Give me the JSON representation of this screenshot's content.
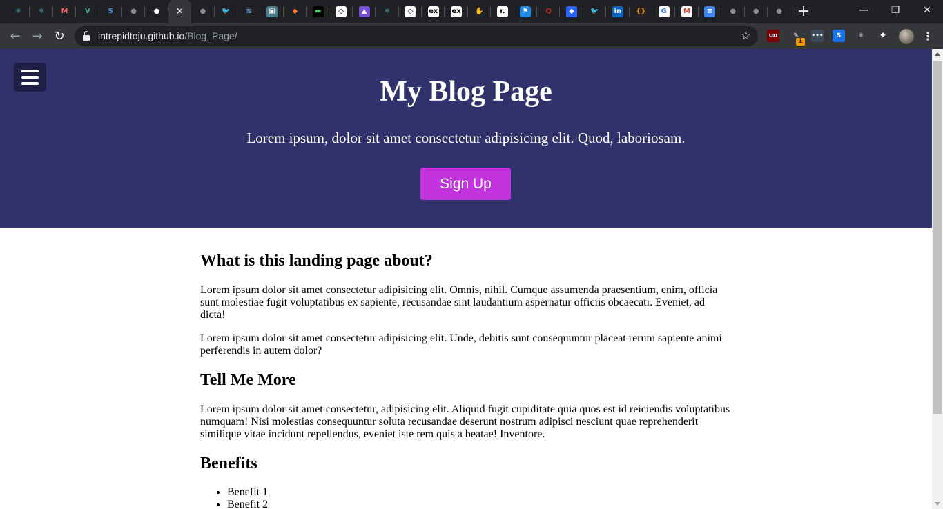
{
  "browser": {
    "tabs": [
      {
        "icon": "react-icon",
        "glyph": "⚛",
        "color": "#61dafb",
        "bg": "transparent"
      },
      {
        "icon": "react-icon",
        "glyph": "⚛",
        "color": "#61dafb",
        "bg": "transparent"
      },
      {
        "icon": "m-logo-icon",
        "glyph": "M",
        "color": "#ff5a5f",
        "bg": "transparent"
      },
      {
        "icon": "vue-icon",
        "glyph": "V",
        "color": "#41b883",
        "bg": "transparent"
      },
      {
        "icon": "s-logo-icon",
        "glyph": "S",
        "color": "#4a90e2",
        "bg": "transparent"
      },
      {
        "icon": "globe-icon",
        "glyph": "●",
        "color": "#8a8d91",
        "bg": "transparent"
      },
      {
        "icon": "github-icon",
        "glyph": "●",
        "color": "#ffffff",
        "bg": "transparent"
      },
      {
        "icon": "close-icon",
        "glyph": "✕",
        "color": "#e8eaed",
        "bg": "transparent",
        "active": true
      },
      {
        "icon": "globe-icon",
        "glyph": "●",
        "color": "#8a8d91",
        "bg": "transparent"
      },
      {
        "icon": "twitter-icon",
        "glyph": "🐦",
        "color": "#1da1f2",
        "bg": "transparent"
      },
      {
        "icon": "wifi-icon",
        "glyph": "≋",
        "color": "#5f9ae8",
        "bg": "transparent"
      },
      {
        "icon": "image-icon",
        "glyph": "▣",
        "color": "#ffffff",
        "bg": "#4a7d8c"
      },
      {
        "icon": "cat-icon",
        "glyph": "◆",
        "color": "#ff7a2e",
        "bg": "transparent"
      },
      {
        "icon": "terminal-icon",
        "glyph": "▬",
        "color": "#3fd16b",
        "bg": "#000000"
      },
      {
        "icon": "codepen-icon",
        "glyph": "◇",
        "color": "#000000",
        "bg": "#ffffff"
      },
      {
        "icon": "triangle-icon",
        "glyph": "▲",
        "color": "#ffffff",
        "bg": "#7b4fd6"
      },
      {
        "icon": "react-icon",
        "glyph": "⚛",
        "color": "#61dafb",
        "bg": "transparent"
      },
      {
        "icon": "codepen-icon",
        "glyph": "◇",
        "color": "#000000",
        "bg": "#ffffff"
      },
      {
        "icon": "ex-icon",
        "glyph": "ex",
        "color": "#000000",
        "bg": "#ffffff"
      },
      {
        "icon": "ex-icon",
        "glyph": "ex",
        "color": "#000000",
        "bg": "#ffffff"
      },
      {
        "icon": "hand-icon",
        "glyph": "✋",
        "color": "#f7c948",
        "bg": "transparent"
      },
      {
        "icon": "r-logo-icon",
        "glyph": "r.",
        "color": "#000000",
        "bg": "#ffffff"
      },
      {
        "icon": "flag-icon",
        "glyph": "⚑",
        "color": "#ffffff",
        "bg": "#1e88e5"
      },
      {
        "icon": "quora-icon",
        "glyph": "Q",
        "color": "#b92b27",
        "bg": "transparent"
      },
      {
        "icon": "diamond-icon",
        "glyph": "◆",
        "color": "#ffffff",
        "bg": "#2962ff"
      },
      {
        "icon": "twitter-icon",
        "glyph": "🐦",
        "color": "#1da1f2",
        "bg": "transparent"
      },
      {
        "icon": "linkedin-icon",
        "glyph": "in",
        "color": "#ffffff",
        "bg": "#0a66c2"
      },
      {
        "icon": "braces-icon",
        "glyph": "{}",
        "color": "#ff8c00",
        "bg": "transparent"
      },
      {
        "icon": "google-icon",
        "glyph": "G",
        "color": "#4285f4",
        "bg": "#ffffff"
      },
      {
        "icon": "gmail-icon",
        "glyph": "M",
        "color": "#ea4335",
        "bg": "#ffffff"
      },
      {
        "icon": "docs-icon",
        "glyph": "≡",
        "color": "#ffffff",
        "bg": "#4285f4"
      },
      {
        "icon": "globe-icon",
        "glyph": "●",
        "color": "#8a8d91",
        "bg": "transparent"
      },
      {
        "icon": "globe-icon",
        "glyph": "●",
        "color": "#8a8d91",
        "bg": "transparent"
      },
      {
        "icon": "globe-icon",
        "glyph": "●",
        "color": "#8a8d91",
        "bg": "transparent"
      }
    ],
    "url_host": "intrepidtoju.github.io",
    "url_path": "/Blog_Page/",
    "extension_badge": "1",
    "extensions": [
      {
        "icon": "ublock-icon",
        "glyph": "uo",
        "bg": "#800000"
      },
      {
        "icon": "wallet-icon",
        "glyph": "✎",
        "bg": "transparent"
      },
      {
        "icon": "dots-extension-icon",
        "glyph": "•••",
        "bg": "#3c4b57"
      },
      {
        "icon": "s-extension-icon",
        "glyph": "S",
        "bg": "#1a73e8"
      },
      {
        "icon": "react-devtools-icon",
        "glyph": "⚛",
        "bg": "transparent"
      },
      {
        "icon": "puzzle-icon",
        "glyph": "✚",
        "bg": "transparent"
      }
    ]
  },
  "page": {
    "hero": {
      "title": "My Blog Page",
      "subtitle": "Lorem ipsum, dolor sit amet consectetur adipisicing elit. Quod, laboriosam.",
      "cta": "Sign Up",
      "background": "#31316b",
      "cta_color": "#c233de"
    },
    "sections": {
      "about_heading": "What is this landing page about?",
      "about_p1": "Lorem ipsum dolor sit amet consectetur adipisicing elit. Omnis, nihil. Cumque assumenda praesentium, enim, officia sunt molestiae fugit voluptatibus ex sapiente, recusandae sint laudantium aspernatur officiis obcaecati. Eveniet, ad dicta!",
      "about_p2": "Lorem ipsum dolor sit amet consectetur adipisicing elit. Unde, debitis sunt consequuntur placeat rerum sapiente animi perferendis in autem dolor?",
      "more_heading": "Tell Me More",
      "more_p1": "Lorem ipsum dolor sit amet consectetur, adipisicing elit. Aliquid fugit cupiditate quia quos est id reiciendis voluptatibus numquam! Nisi molestias consequuntur soluta recusandae deserunt nostrum adipisci nesciunt quae reprehenderit similique vitae incidunt repellendus, eveniet iste rem quis a beatae! Inventore.",
      "benefits_heading": "Benefits",
      "benefits": [
        "Benefit 1",
        "Benefit 2"
      ]
    }
  }
}
